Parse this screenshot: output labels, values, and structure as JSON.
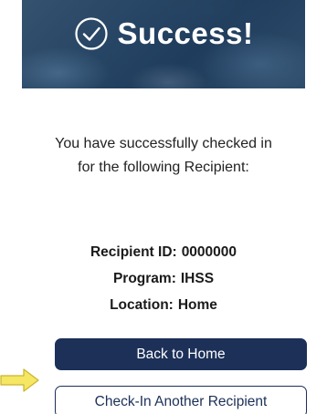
{
  "banner": {
    "title": "Success!",
    "icon": "check-circle-icon"
  },
  "message": {
    "line1": "You have successfully checked in",
    "line2": "for the following Recipient:"
  },
  "recipient": {
    "id_label": "Recipient ID:",
    "id_value": "0000000",
    "program_label": "Program:",
    "program_value": "IHSS",
    "location_label": "Location:",
    "location_value": "Home"
  },
  "buttons": {
    "back_home": "Back to Home",
    "check_in_another": "Check-In Another Recipient"
  },
  "annotation": {
    "icon": "pointer-arrow-icon",
    "color": "#f5e663"
  },
  "colors": {
    "primary": "#1c3058",
    "banner": "#274564"
  }
}
